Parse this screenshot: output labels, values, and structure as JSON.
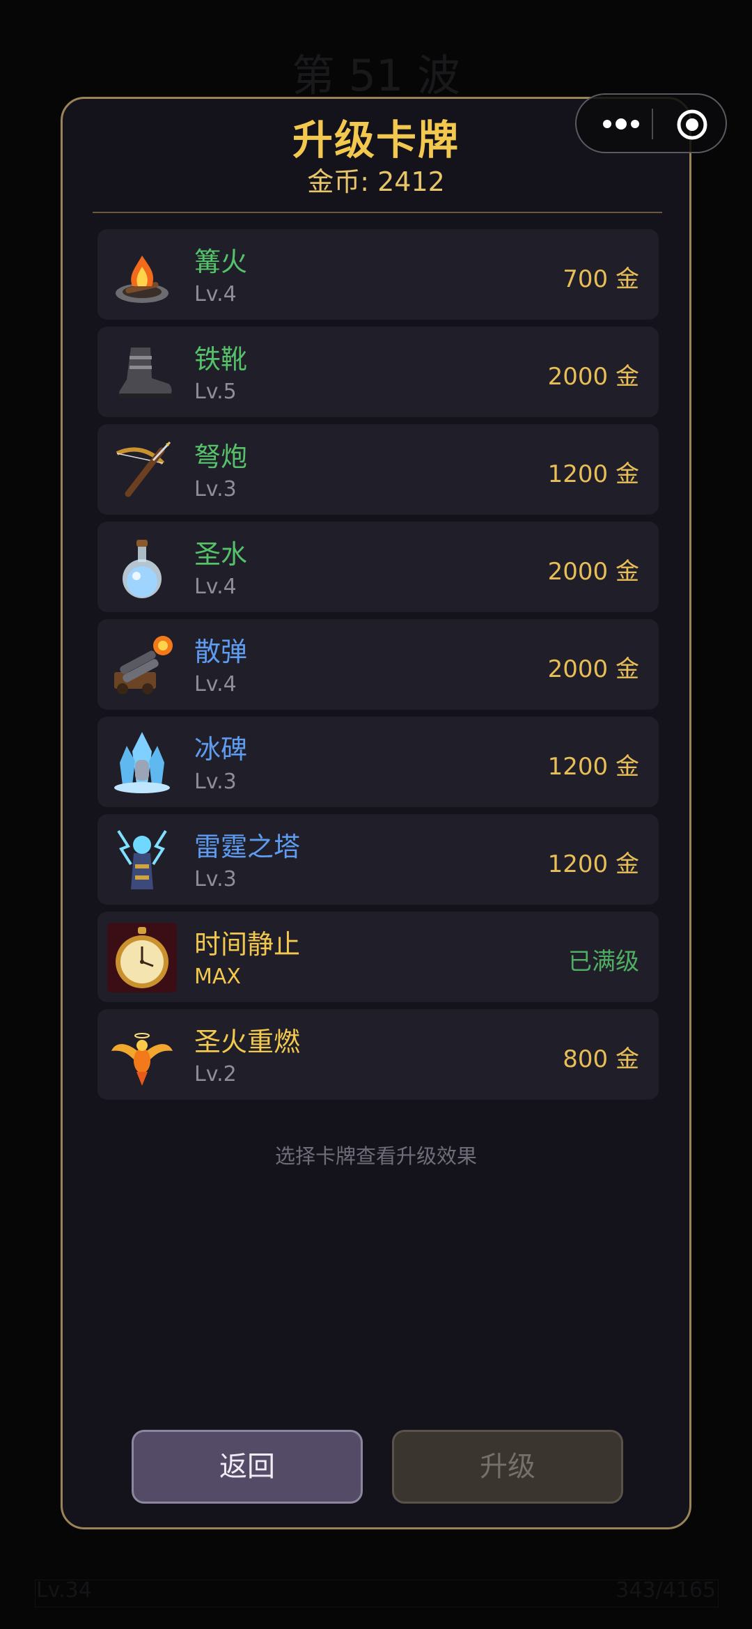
{
  "background": {
    "wave_title": "第 51 波",
    "level": "Lv.34",
    "xp": "343/4165"
  },
  "capsule": {
    "more_icon": "more-dots-icon",
    "close_icon": "target-close-icon"
  },
  "modal": {
    "title": "升级卡牌",
    "coins": "金币: 2412",
    "hint": "选择卡牌查看升级效果",
    "back_label": "返回",
    "upgrade_label": "升级"
  },
  "colors": {
    "name_green": "#55c26a",
    "name_blue": "#5d9cf0",
    "name_gold": "#f2c84e",
    "price_gold": "#e7be57",
    "maxed_green": "#4fae62",
    "modal_border": "#9b8456"
  },
  "cards": [
    {
      "name": "篝火",
      "level": "Lv.4",
      "price": "700 金",
      "icon": "campfire-icon",
      "tier": "green"
    },
    {
      "name": "铁靴",
      "level": "Lv.5",
      "price": "2000 金",
      "icon": "iron-boot-icon",
      "tier": "green"
    },
    {
      "name": "弩炮",
      "level": "Lv.3",
      "price": "1200 金",
      "icon": "crossbow-icon",
      "tier": "green"
    },
    {
      "name": "圣水",
      "level": "Lv.4",
      "price": "2000 金",
      "icon": "holy-water-flask-icon",
      "tier": "green"
    },
    {
      "name": "散弹",
      "level": "Lv.4",
      "price": "2000 金",
      "icon": "shotgun-cannon-icon",
      "tier": "blue"
    },
    {
      "name": "冰碑",
      "level": "Lv.3",
      "price": "1200 金",
      "icon": "ice-tombstone-icon",
      "tier": "blue"
    },
    {
      "name": "雷霆之塔",
      "level": "Lv.3",
      "price": "1200 金",
      "icon": "thunder-tower-icon",
      "tier": "blue"
    },
    {
      "name": "时间静止",
      "level": "MAX",
      "price": "已满级",
      "icon": "pocket-watch-icon",
      "tier": "gold",
      "maxed": true
    },
    {
      "name": "圣火重燃",
      "level": "Lv.2",
      "price": "800 金",
      "icon": "phoenix-icon",
      "tier": "gold"
    }
  ]
}
